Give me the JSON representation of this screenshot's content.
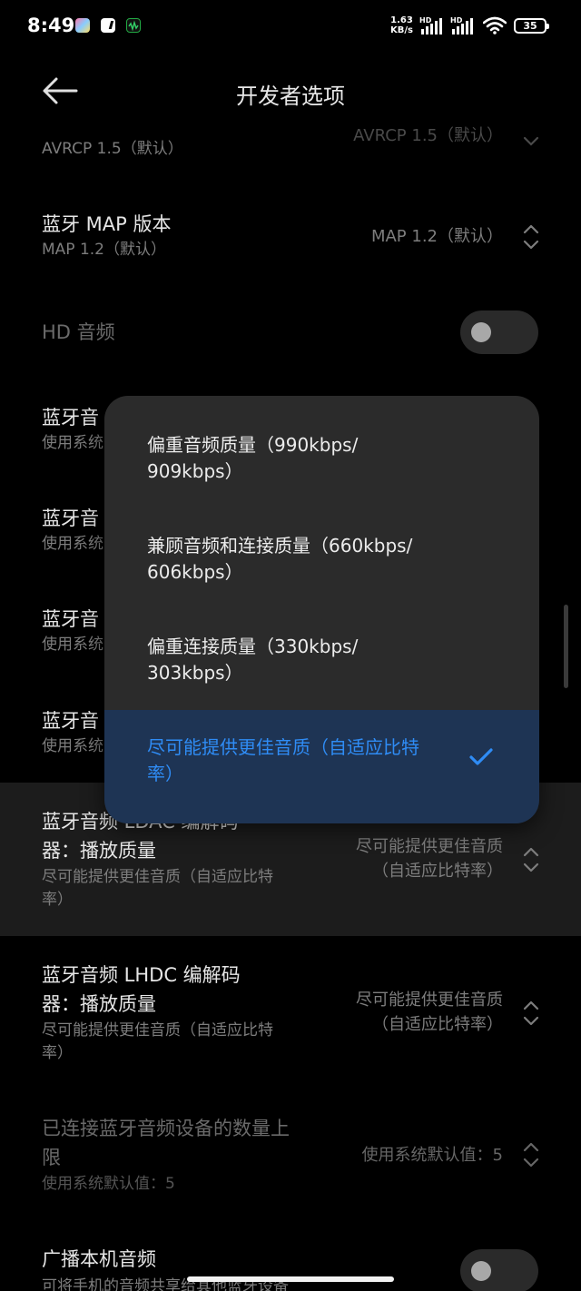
{
  "status_bar": {
    "time": "8:49",
    "net_speed_value": "1.63",
    "net_speed_unit": "KB/s",
    "signal1_tag": "HD",
    "signal2_tag": "HD",
    "battery": "35"
  },
  "header": {
    "title": "开发者选项"
  },
  "rows": {
    "avrcp": {
      "sub": "AVRCP 1.5（默认）",
      "value": "AVRCP 1.5（默认）"
    },
    "map": {
      "title": "蓝牙 MAP 版本",
      "sub": "MAP 1.2（默认）",
      "value": "MAP 1.2（默认）"
    },
    "hd_audio": {
      "title": "HD 音频",
      "enabled": false
    },
    "codec1": {
      "title": "蓝牙音",
      "sub": "使用系统"
    },
    "codec2": {
      "title": "蓝牙音",
      "sub": "使用系统"
    },
    "codec3": {
      "title": "蓝牙音",
      "sub": "使用系统"
    },
    "codec4": {
      "title": "蓝牙音",
      "sub": "使用系统"
    },
    "ldac": {
      "title_line1": "蓝牙音频 LDAC 编解码",
      "title_line2": "器：播放质量",
      "sub_line1": "尽可能提供更佳音质（自适应比特",
      "sub_line2": "率）",
      "value_line1": "尽可能提供更佳音质",
      "value_line2": "（自适应比特率）"
    },
    "lhdc": {
      "title_line1": "蓝牙音频 LHDC 编解码",
      "title_line2": "器：播放质量",
      "sub_line1": "尽可能提供更佳音质（自适应比特",
      "sub_line2": "率）",
      "value_line1": "尽可能提供更佳音质",
      "value_line2": "（自适应比特率）"
    },
    "max_devices": {
      "title_line1": "已连接蓝牙音频设备的数量上",
      "title_line2": "限",
      "sub": "使用系统默认值：5",
      "value": "使用系统默认值：5"
    },
    "broadcast": {
      "title": "广播本机音频",
      "sub": "可将手机的音频共享给其他蓝牙设备",
      "enabled": false
    }
  },
  "popup": {
    "options": [
      {
        "line1": "偏重音频质量（990kbps/",
        "line2": "909kbps）",
        "selected": false
      },
      {
        "line1": "兼顾音频和连接质量（660kbps/",
        "line2": "606kbps）",
        "selected": false
      },
      {
        "line1": "偏重连接质量（330kbps/",
        "line2": "303kbps）",
        "selected": false
      },
      {
        "line1": "尽可能提供更佳音质（自适应比特",
        "line2": "率）",
        "selected": true
      }
    ]
  },
  "colors": {
    "background": "#000000",
    "popup_bg": "#2b2b2b",
    "selected_bg": "#1e3454",
    "accent": "#2f8cf5"
  }
}
